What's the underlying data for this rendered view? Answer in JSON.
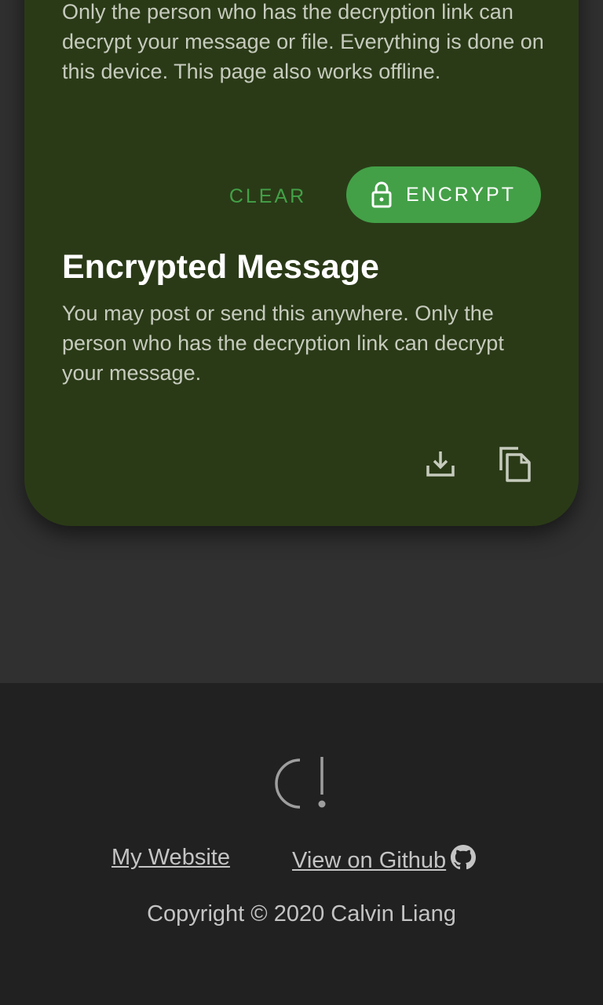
{
  "card": {
    "intro_text": "Only the person who has the decryption link can decrypt your message or file. Everything is done on this device. This page also works offline.",
    "clear_label": "CLEAR",
    "encrypt_label": "ENCRYPT",
    "encrypt_icon": "lock-icon",
    "output_title": "Encrypted Message",
    "output_desc": "You may post or send this anywhere. Only the person who has the decryption link can decrypt your message.",
    "download_icon": "download-icon",
    "copy_icon": "copy-icon"
  },
  "footer": {
    "logo_icon": "logo-icon",
    "website_label": "My Website",
    "github_label": "View on Github ",
    "github_icon": "github-icon",
    "copyright": "Copyright © 2020 Calvin Liang"
  },
  "colors": {
    "card_bg": "#2a3a17",
    "accent": "#43a047",
    "page_bg": "#303030",
    "footer_bg": "#212121"
  }
}
